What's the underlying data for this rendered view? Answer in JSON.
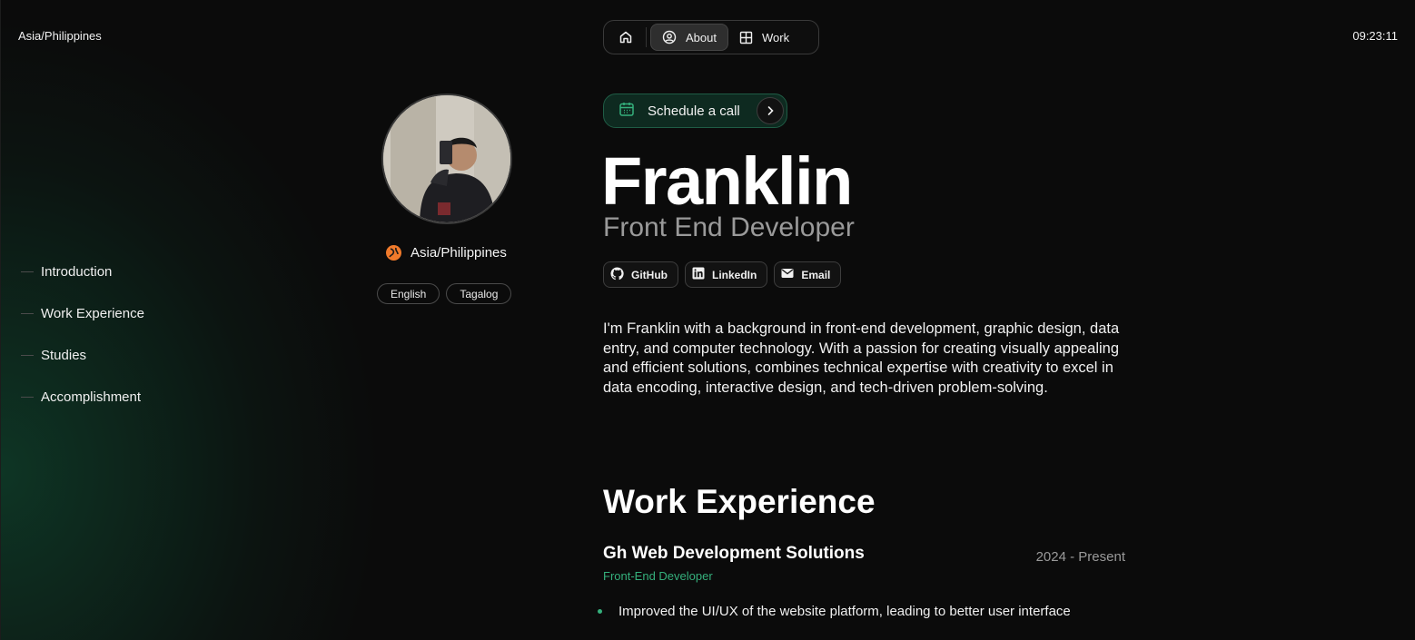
{
  "header": {
    "timezone": "Asia/Philippines",
    "time": "09:23:11"
  },
  "nav": {
    "home_icon": "home-icon",
    "items": [
      {
        "label": "About",
        "icon": "person-circle-icon",
        "active": true
      },
      {
        "label": "Work",
        "icon": "grid-icon",
        "active": false
      }
    ]
  },
  "sidebar": {
    "items": [
      {
        "label": "Introduction"
      },
      {
        "label": "Work Experience"
      },
      {
        "label": "Studies"
      },
      {
        "label": "Accomplishment"
      }
    ]
  },
  "profile": {
    "location": "Asia/Philippines",
    "languages": [
      "English",
      "Tagalog"
    ],
    "accent": "#f07a2b"
  },
  "hero": {
    "schedule_label": "Schedule a call",
    "name": "Franklin",
    "role": "Front End Developer",
    "socials": [
      {
        "label": "GitHub",
        "icon": "github-icon"
      },
      {
        "label": "LinkedIn",
        "icon": "linkedin-icon"
      },
      {
        "label": "Email",
        "icon": "email-icon"
      }
    ],
    "intro": "I'm Franklin with a background in front-end development, graphic design, data entry, and computer technology. With a passion for creating visually appealing and efficient solutions, combines technical expertise with creativity to excel in data encoding, interactive design, and tech-driven problem-solving."
  },
  "work": {
    "heading": "Work Experience",
    "jobs": [
      {
        "company": "Gh Web Development Solutions",
        "dates": "2024 - Present",
        "role": "Front-End Developer",
        "bullets": [
          "Improved the UI/UX of the website platform, leading to better user interface"
        ]
      }
    ]
  },
  "colors": {
    "accent_green": "#35b07c",
    "background": "#0b0b0b"
  }
}
